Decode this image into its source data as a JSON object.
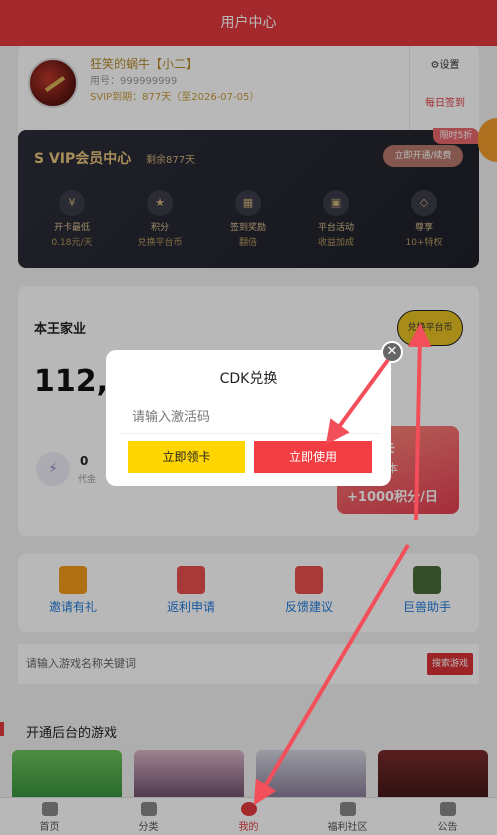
{
  "header": {
    "title": "用户中心"
  },
  "user": {
    "name": "狂笑的蜗牛【小二】",
    "uid": "用号：999999999",
    "svip": "SVIP到期：877天（至2026-07-05）",
    "settings_label": "⚙设置",
    "signin_label": "每日签到"
  },
  "vip": {
    "title": "S VIP会员中心",
    "remain": "剩余877天",
    "action": "立即开通/续费",
    "badge": "限时5折",
    "features": [
      {
        "icon": "¥",
        "line1": "开卡最低",
        "line2": "0.18元/天"
      },
      {
        "icon": "★",
        "line1": "积分",
        "line2": "兑换平台币"
      },
      {
        "icon": "▦",
        "line1": "签到奖励",
        "line2": "翻倍"
      },
      {
        "icon": "▣",
        "line1": "平台活动",
        "line2": "收益加成"
      },
      {
        "icon": "◇",
        "line1": "尊享",
        "line2": "10+特权"
      }
    ]
  },
  "home": {
    "title": "本王家业",
    "exchange_btn": "兑换平台币",
    "points": "112,4",
    "zero_value": "0",
    "zero_label": "代金",
    "promo_line1": "钱卡",
    "promo_line2": "即回本",
    "promo_line3": "+1000积分/日"
  },
  "shortcuts": [
    {
      "label": "邀请有礼",
      "color": "#f39c1c"
    },
    {
      "label": "返利申请",
      "color": "#e85050"
    },
    {
      "label": "反馈建议",
      "color": "#e85050"
    },
    {
      "label": "巨兽助手",
      "color": "#4a6b3a"
    }
  ],
  "search": {
    "placeholder": "请输入游戏名称关键词",
    "button": "搜索游戏"
  },
  "games_section": {
    "title": "开通后台的游戏"
  },
  "tabbar": [
    {
      "label": "首页"
    },
    {
      "label": "分类"
    },
    {
      "label": "我的"
    },
    {
      "label": "福利社区"
    },
    {
      "label": "公告"
    }
  ],
  "modal": {
    "title": "CDK兑换",
    "placeholder": "请输入激活码",
    "claim_button": "立即领卡",
    "use_button": "立即使用",
    "close_symbol": "✕"
  },
  "colors": {
    "accent": "#e23a3f",
    "gold": "#e9c325"
  }
}
